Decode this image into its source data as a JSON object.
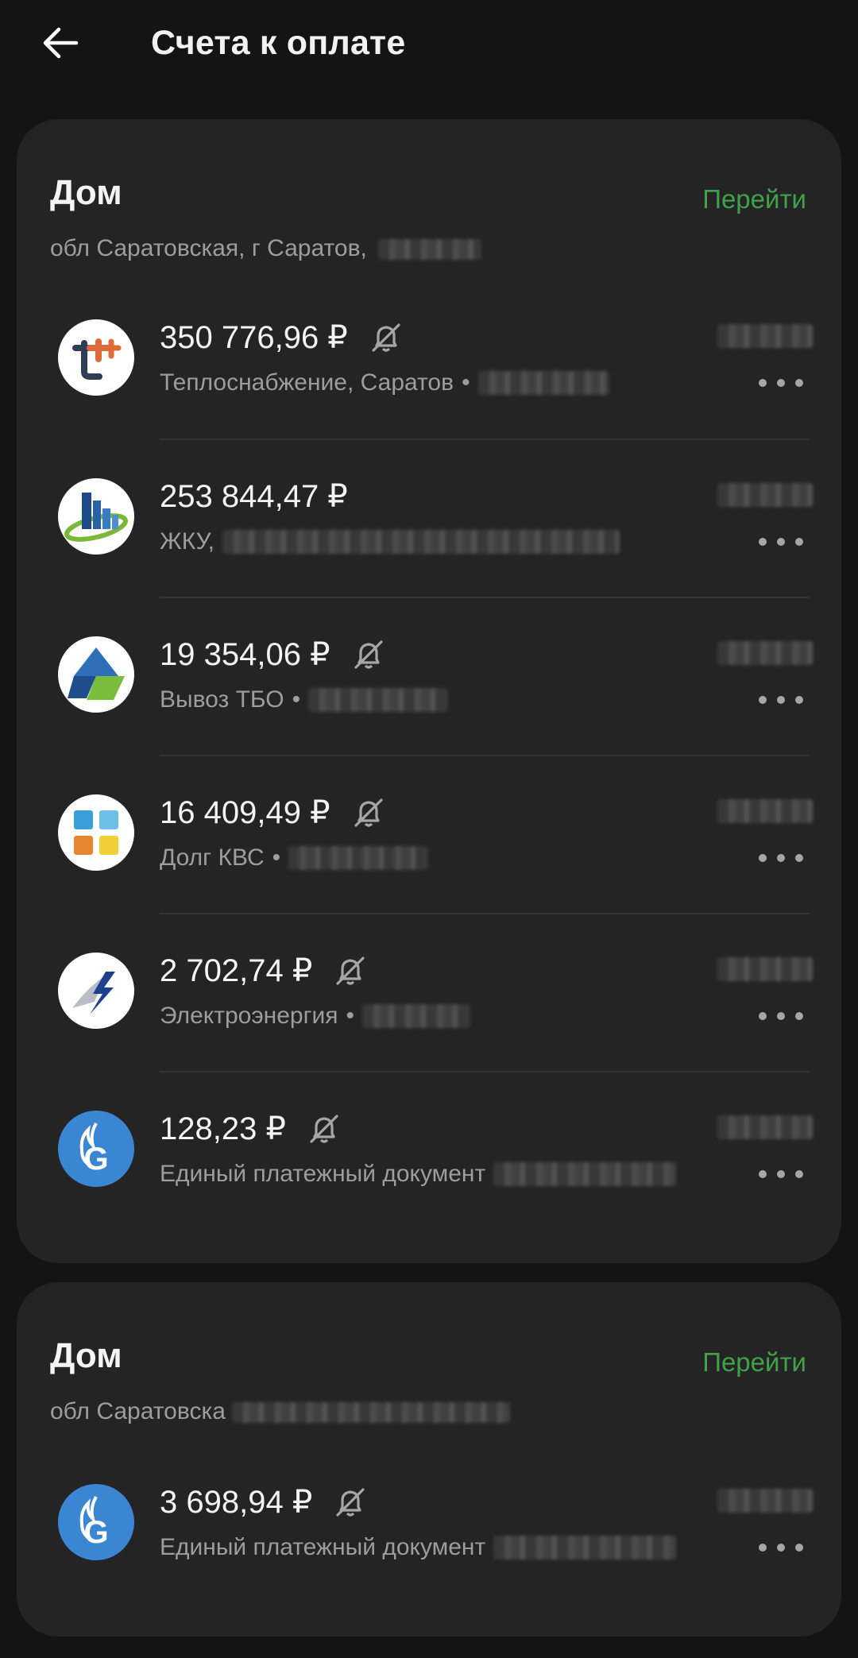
{
  "header": {
    "title": "Счета к оплате",
    "back_icon": "arrow-left-icon"
  },
  "colors": {
    "background": "#141414",
    "card": "#242424",
    "accent": "#3fa24a",
    "muted": "#9d9d9d"
  },
  "groups": [
    {
      "title": "Дом",
      "link": "Перейти",
      "address": "обл Саратовская, г Саратов,",
      "bills": [
        {
          "amount": "350 776,96 ₽",
          "description": "Теплоснабжение, Саратов",
          "separator": "•",
          "logo": "teplo-logo-icon",
          "notifications_off": true
        },
        {
          "amount": "253 844,47 ₽",
          "description": "ЖКУ,",
          "separator": "",
          "logo": "zhku-logo-icon",
          "notifications_off": false
        },
        {
          "amount": "19 354,06 ₽",
          "description": "Вывоз ТБО",
          "separator": "•",
          "logo": "tbo-logo-icon",
          "notifications_off": true
        },
        {
          "amount": "16 409,49 ₽",
          "description": "Долг КВС",
          "separator": "•",
          "logo": "kvs-logo-icon",
          "notifications_off": true
        },
        {
          "amount": "2 702,74 ₽",
          "description": "Электроэнергия",
          "separator": "•",
          "logo": "electricity-logo-icon",
          "notifications_off": true
        },
        {
          "amount": "128,23 ₽",
          "description": "Единый платежный документ",
          "separator": "",
          "logo": "gazprom-logo-icon",
          "notifications_off": true
        }
      ]
    },
    {
      "title": "Дом",
      "link": "Перейти",
      "address": "обл Саратовска",
      "bills": [
        {
          "amount": "3 698,94 ₽",
          "description": "Единый платежный документ",
          "separator": "",
          "logo": "gazprom-logo-icon",
          "notifications_off": true
        }
      ]
    }
  ]
}
